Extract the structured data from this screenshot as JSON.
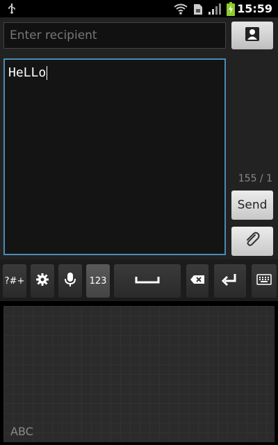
{
  "status_bar": {
    "time": "15:59",
    "icons": [
      "usb-icon",
      "wifi-icon",
      "sim-icon",
      "signal-icon",
      "battery-charging-icon"
    ]
  },
  "compose": {
    "recipient_placeholder": "Enter recipient",
    "recipient_value": "",
    "message_text": "HeLLo",
    "counter": "155 / 1",
    "send_label": "Send"
  },
  "keyboard": {
    "symbols_label": "?#+",
    "numbers_label": "123",
    "pad_mode_label": "ABC"
  },
  "colors": {
    "accent_focus": "#4a8bb6",
    "battery": "#8ecb2b"
  }
}
